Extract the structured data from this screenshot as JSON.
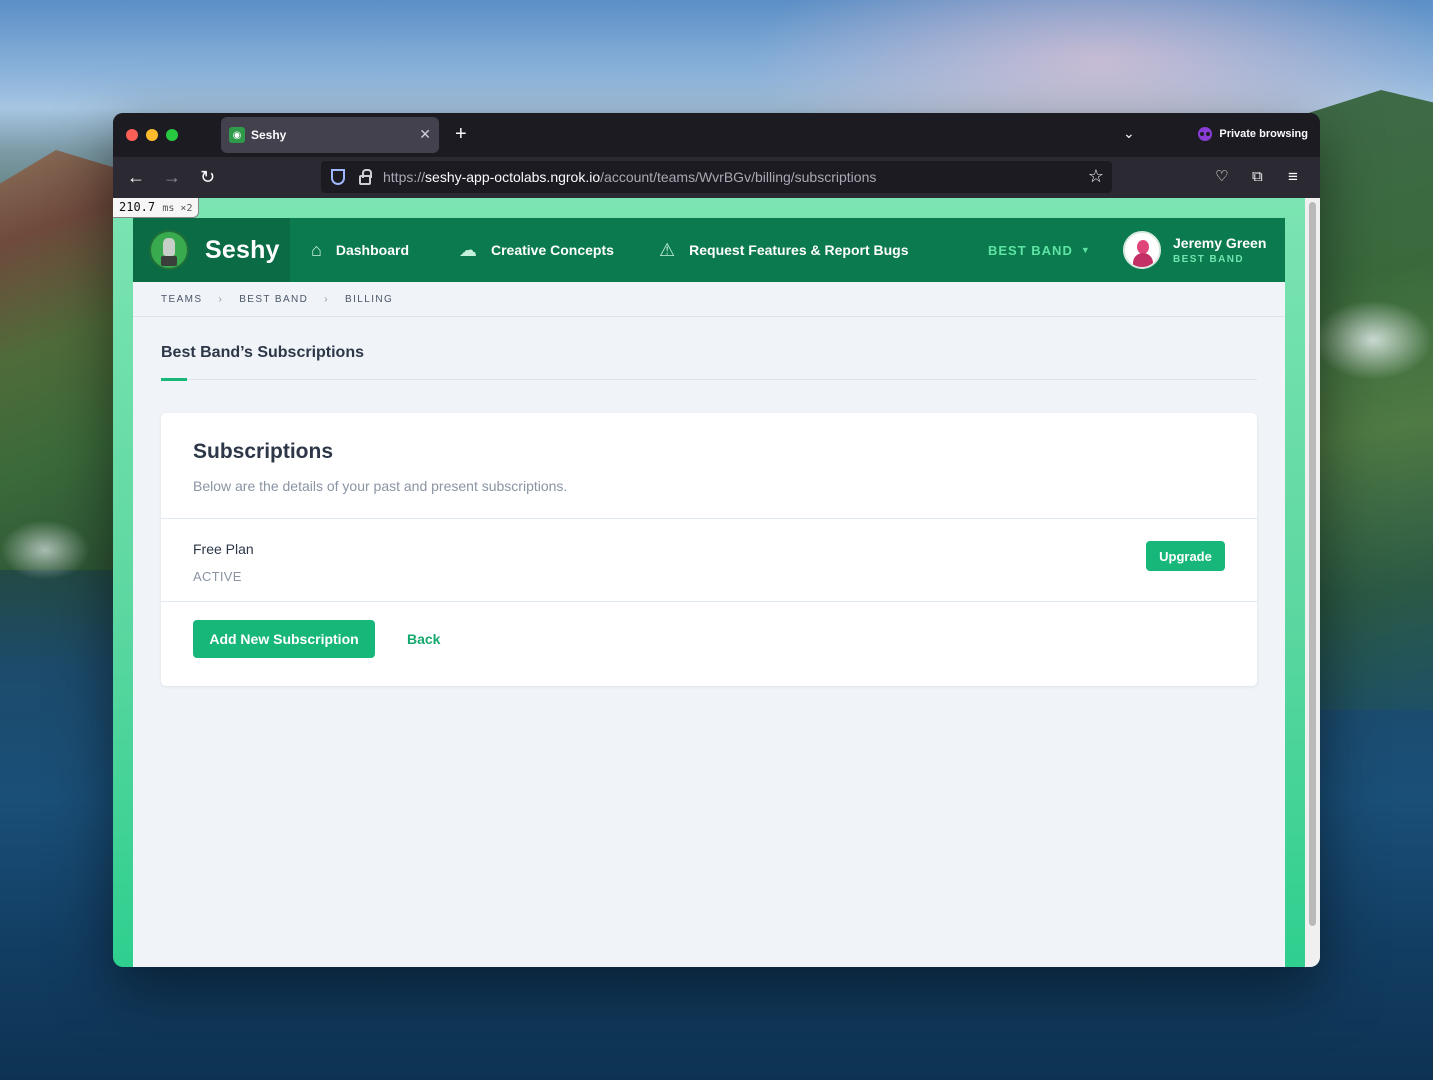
{
  "browser": {
    "tab_title": "Seshy",
    "private_label": "Private browsing",
    "url_prefix": "https://",
    "url_host": "seshy-app-octolabs.ngrok.io",
    "url_path": "/account/teams/WvrBGv/billing/subscriptions",
    "timer_value": "210.7",
    "timer_unit": "ms ×2"
  },
  "header": {
    "brand": "Seshy",
    "nav": [
      {
        "label": "Dashboard",
        "icon": "home-icon"
      },
      {
        "label": "Creative Concepts",
        "icon": "thought-bubble-icon"
      },
      {
        "label": "Request Features & Report Bugs",
        "icon": "warning-triangle-icon"
      }
    ],
    "team_switcher": "BEST BAND",
    "user_name": "Jeremy Green",
    "user_team": "BEST BAND"
  },
  "breadcrumb": [
    "TEAMS",
    "BEST BAND",
    "BILLING"
  ],
  "page": {
    "title": "Best Band’s Subscriptions"
  },
  "card": {
    "title": "Subscriptions",
    "description": "Below are the details of your past and present subscriptions.",
    "subscription": {
      "plan": "Free Plan",
      "status": "ACTIVE",
      "upgrade_label": "Upgrade"
    },
    "add_label": "Add New Subscription",
    "back_label": "Back"
  },
  "colors": {
    "header_bg": "#0b7a4e",
    "brand_bg": "#0a6b44",
    "accent": "#17b77a",
    "page_bg": "#f0f4f8"
  }
}
